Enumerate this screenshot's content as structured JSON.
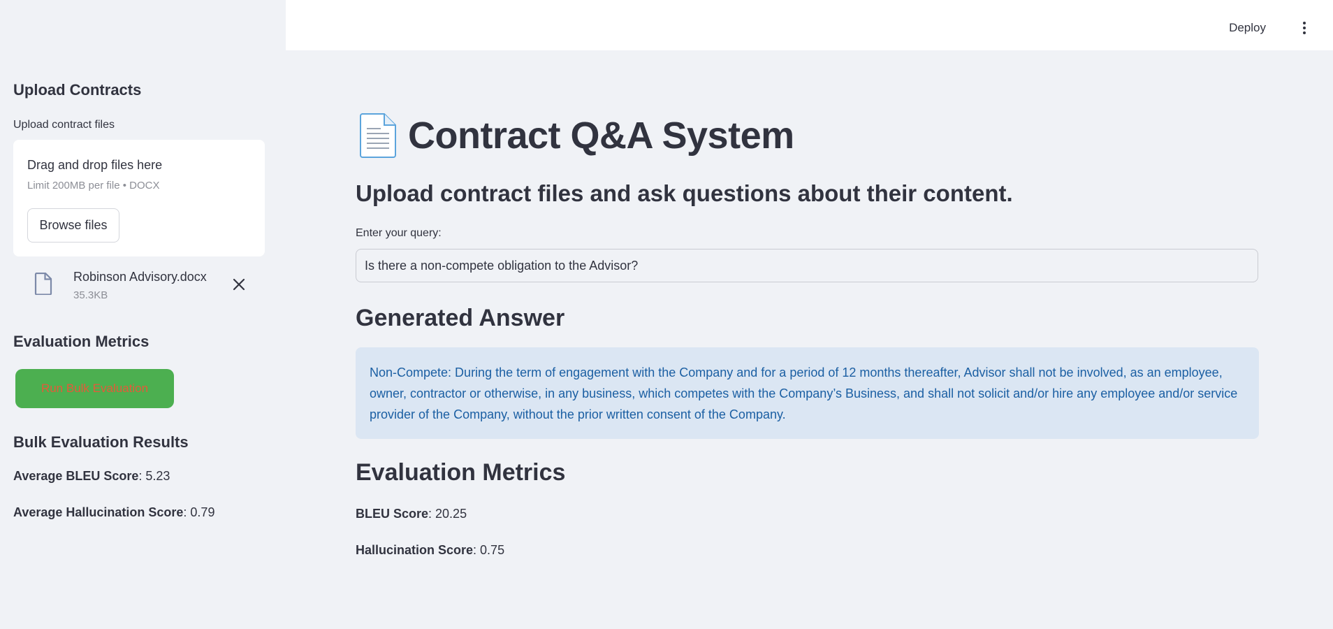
{
  "header": {
    "deploy_label": "Deploy",
    "menu_icon": "kebab-menu-icon"
  },
  "sidebar": {
    "upload_heading": "Upload Contracts",
    "upload_label": "Upload contract files",
    "dropzone": {
      "title": "Drag and drop files here",
      "limit": "Limit 200MB per file • DOCX",
      "browse_label": "Browse files"
    },
    "file": {
      "name": "Robinson Advisory.docx",
      "size": "35.3KB",
      "icon": "file-icon",
      "remove_icon": "close-icon"
    },
    "eval_heading": "Evaluation Metrics",
    "run_button_label": "Run Bulk Evaluation",
    "results_heading": "Bulk Evaluation Results",
    "avg_bleu_label": "Average BLEU Score",
    "avg_bleu_value": ": 5.23",
    "avg_halluc_label": "Average Hallucination Score",
    "avg_halluc_value": ": 0.79"
  },
  "main": {
    "title": "Contract Q&A System",
    "title_icon": "document-icon",
    "subtitle": "Upload contract files and ask questions about their content.",
    "query_label": "Enter your query:",
    "query_value": "Is there a non-compete obligation to the Advisor?",
    "answer_heading": "Generated Answer",
    "answer_text": "Non-Compete: During the term of engagement with the Company and for a period of 12 months thereafter, Advisor shall not be involved, as an employee, owner, contractor or otherwise, in any business, which competes with the Company’s Business, and shall not solicit and/or hire any employee and/or service provider of the Company, without the prior written consent of the Company.",
    "metrics_heading": "Evaluation Metrics",
    "bleu_label": "BLEU Score",
    "bleu_value": ": 20.25",
    "halluc_label": "Hallucination Score",
    "halluc_value": ": 0.75"
  },
  "colors": {
    "background": "#f0f2f6",
    "run_button_bg": "#4caf50",
    "run_button_text": "#e45a39",
    "answer_bg": "#dbe6f3",
    "answer_text": "#1b5fa3"
  }
}
